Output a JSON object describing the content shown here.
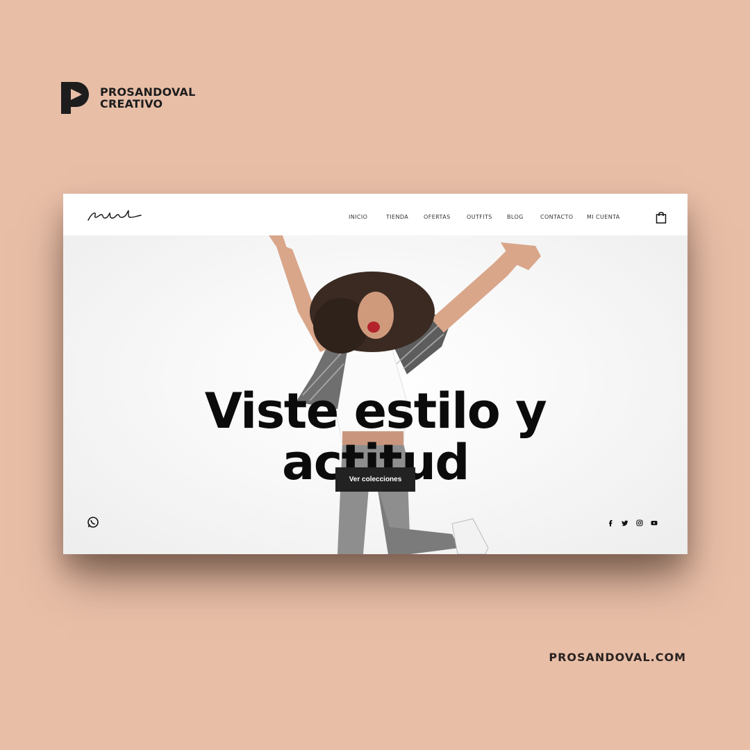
{
  "brand": {
    "line1": "PROSANDOVAL",
    "line2": "CREATIVO",
    "url": "PROSANDOVAL.COM"
  },
  "site": {
    "logo_text": "rebel",
    "nav": [
      "INICIO",
      "TIENDA",
      "OFERTAS",
      "OUTFITS",
      "BLOG",
      "CONTACTO",
      "MI CUENTA"
    ],
    "hero": {
      "headline_line1": "Viste estilo y",
      "headline_line2": "actitud",
      "cta_label": "Ver colecciones"
    },
    "icons": {
      "cart": "shopping-bag-icon",
      "whatsapp": "whatsapp-icon",
      "social": [
        "facebook-icon",
        "twitter-icon",
        "instagram-icon",
        "youtube-icon"
      ]
    }
  },
  "colors": {
    "background": "#e8bea7",
    "cta": "#222222",
    "text": "#0b0b0b"
  }
}
